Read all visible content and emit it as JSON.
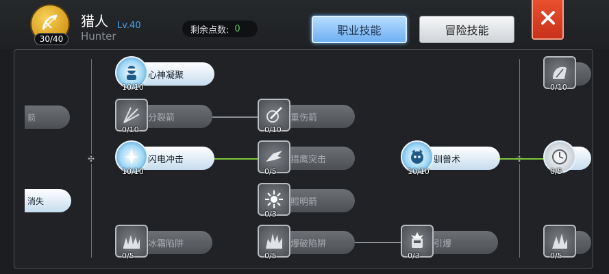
{
  "header": {
    "job_name": "猎人",
    "job_level": "Lv.40",
    "job_name_en": "Hunter",
    "job_progress": "30/40",
    "points_label": "剩余点数:",
    "points_value": "0",
    "tabs": [
      {
        "label": "职业技能",
        "active": true
      },
      {
        "label": "冒险技能",
        "active": false
      }
    ],
    "close_icon": "close-icon",
    "job_icon": "bow-icon"
  },
  "left_partial": [
    {
      "label": "箭",
      "state": "locked"
    },
    {
      "label": "消失",
      "state": "active"
    }
  ],
  "skills": [
    {
      "name": "心神凝聚",
      "level": "10/10",
      "state": "active",
      "icon": "meditation-icon"
    },
    {
      "name": "分裂箭",
      "level": "0/10",
      "state": "locked",
      "icon": "split-arrow-icon"
    },
    {
      "name": "闪电冲击",
      "level": "10/10",
      "state": "active",
      "icon": "lightning-icon"
    },
    {
      "name": "冰霜陷阱",
      "level": "0/5",
      "state": "locked",
      "icon": "frost-trap-icon"
    },
    {
      "name": "重伤箭",
      "level": "0/10",
      "state": "locked",
      "icon": "wound-arrow-icon"
    },
    {
      "name": "猎鹰突击",
      "level": "0/5",
      "state": "locked",
      "icon": "falcon-icon"
    },
    {
      "name": "照明箭",
      "level": "0/3",
      "state": "locked",
      "icon": "flare-arrow-icon"
    },
    {
      "name": "爆破陷阱",
      "level": "0/5",
      "state": "locked",
      "icon": "blast-trap-icon"
    },
    {
      "name": "驯兽术",
      "level": "10/10",
      "state": "active",
      "icon": "beast-icon"
    },
    {
      "name": "引爆",
      "level": "0/3",
      "state": "locked",
      "icon": "detonate-icon"
    }
  ],
  "right_partial": [
    {
      "level": "0/10",
      "state": "locked",
      "icon": "shell-icon"
    },
    {
      "level": "0/5",
      "state": "active",
      "icon": "clock-icon"
    },
    {
      "level": "0/5",
      "state": "locked",
      "icon": "spike-icon"
    }
  ],
  "colors": {
    "accent_blue": "#4aa2e8",
    "points_green": "#55d05a",
    "link_active": "#7ec83c",
    "link_locked": "#8a8f94",
    "close_red": "#d8401f"
  }
}
